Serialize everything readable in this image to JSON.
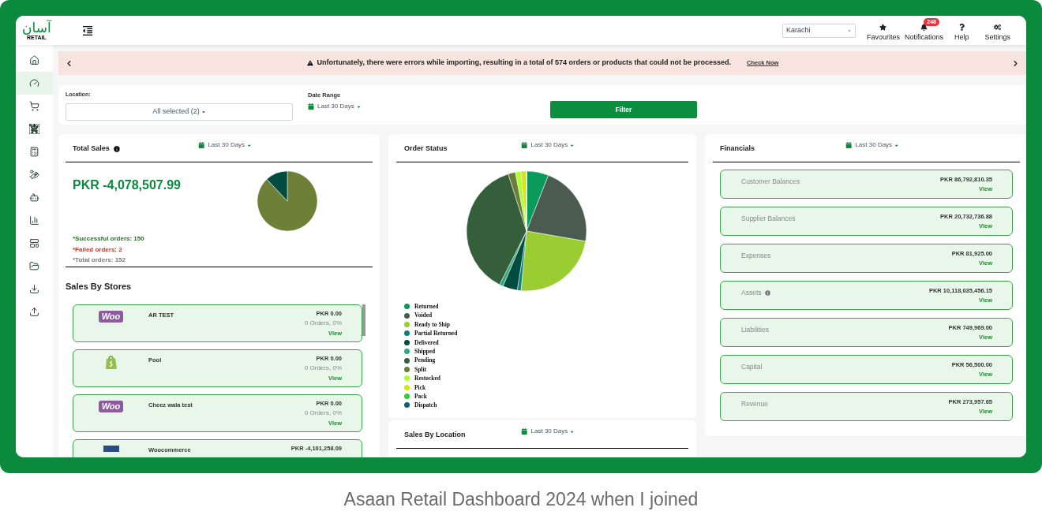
{
  "logo": {
    "script": "آسان",
    "tagline": "RETAIL"
  },
  "header": {
    "location_select": "Karachi",
    "actions": [
      {
        "kind": "favourites",
        "label": "Favourites"
      },
      {
        "kind": "notifications",
        "label": "Notifications",
        "badge": "248"
      },
      {
        "kind": "help",
        "label": "Help"
      },
      {
        "kind": "settings",
        "label": "Settings"
      }
    ]
  },
  "sidebar": {
    "items": [
      {
        "selected": false
      },
      {
        "selected": true
      },
      {
        "selected": false
      },
      {
        "selected": false
      },
      {
        "selected": false
      },
      {
        "selected": false
      },
      {
        "selected": false
      },
      {
        "selected": false
      },
      {
        "selected": false
      },
      {
        "selected": false
      },
      {
        "selected": false
      },
      {
        "selected": false
      }
    ]
  },
  "banner": {
    "message": "Unfortunately, there were errors while importing, resulting in a total of 574 orders or products that could not be processed.",
    "link": "Check Now"
  },
  "filters": {
    "location_label": "Location:",
    "location_value": "All selected (2)",
    "date_label": "Date Range",
    "date_value": "Last 30 Days",
    "button": "Filter"
  },
  "total_sales": {
    "title": "Total Sales",
    "date_value": "Last 30 Days",
    "amount": "PKR -4,078,507.99",
    "successful": "*Successful orders: 150",
    "failed": "*Failed orders: 2",
    "total": "*Total orders: 152"
  },
  "sales_by_stores": {
    "title": "Sales By Stores",
    "stores": [
      {
        "kind": "woo",
        "logo_text": "Woo",
        "name": "AR TEST",
        "amount": "PKR 0.00",
        "orders": "0 Orders, 0%",
        "link": "View"
      },
      {
        "kind": "shopify",
        "name": "Pool",
        "amount": "PKR 0.00",
        "orders": "0 Orders, 0%",
        "link": "View"
      },
      {
        "kind": "woo",
        "logo_text": "Woo",
        "name": "Cheez wala test",
        "amount": "PKR 0.00",
        "orders": "0 Orders, 0%",
        "link": "View"
      },
      {
        "kind": "other",
        "name": "Woocommerce",
        "amount": "PKR -4,101,258.09"
      }
    ]
  },
  "order_status": {
    "title": "Order Status",
    "date_value": "Last 30 Days",
    "legend": [
      {
        "label": "Returned",
        "color": "#0a9a5c"
      },
      {
        "label": "Voided",
        "color": "#4b5b50"
      },
      {
        "label": "Ready to Ship",
        "color": "#9acd32"
      },
      {
        "label": "Partial Returned",
        "color": "#0b8080"
      },
      {
        "label": "Delivered",
        "color": "#004d40"
      },
      {
        "label": "Shipped",
        "color": "#2eaa80"
      },
      {
        "label": "Pending",
        "color": "#355e3b"
      },
      {
        "label": "Split",
        "color": "#6b7f3a"
      },
      {
        "label": "Restocked",
        "color": "#adff2f"
      },
      {
        "label": "Pick",
        "color": "#d4e60f"
      },
      {
        "label": "Pack",
        "color": "#32cd32"
      },
      {
        "label": "Dispatch",
        "color": "#0f6070"
      }
    ]
  },
  "sales_by_location": {
    "title": "Sales By Location",
    "date_value": "Last 30 Days"
  },
  "financials": {
    "title": "Financials",
    "date_value": "Last 30 Days",
    "items": [
      {
        "label": "Customer Balances",
        "info": false,
        "amount": "PKR 86,792,810.35",
        "link": "View"
      },
      {
        "label": "Supplier Balances",
        "info": false,
        "amount": "PKR 20,732,736.88",
        "link": "View"
      },
      {
        "label": "Expenses",
        "info": false,
        "amount": "PKR 81,925.00",
        "link": "View"
      },
      {
        "label": "Assets",
        "info": true,
        "amount": "PKR 10,118,035,456.15",
        "link": "View"
      },
      {
        "label": "Liabilities",
        "info": false,
        "amount": "PKR 749,969.00",
        "link": "View"
      },
      {
        "label": "Capital",
        "info": false,
        "amount": "PKR 56,500.00",
        "link": "View"
      },
      {
        "label": "Revenue",
        "info": false,
        "amount": "PKR 273,957.65",
        "link": "View"
      }
    ]
  },
  "caption": "Asaan Retail Dashboard 2024 when I joined"
}
